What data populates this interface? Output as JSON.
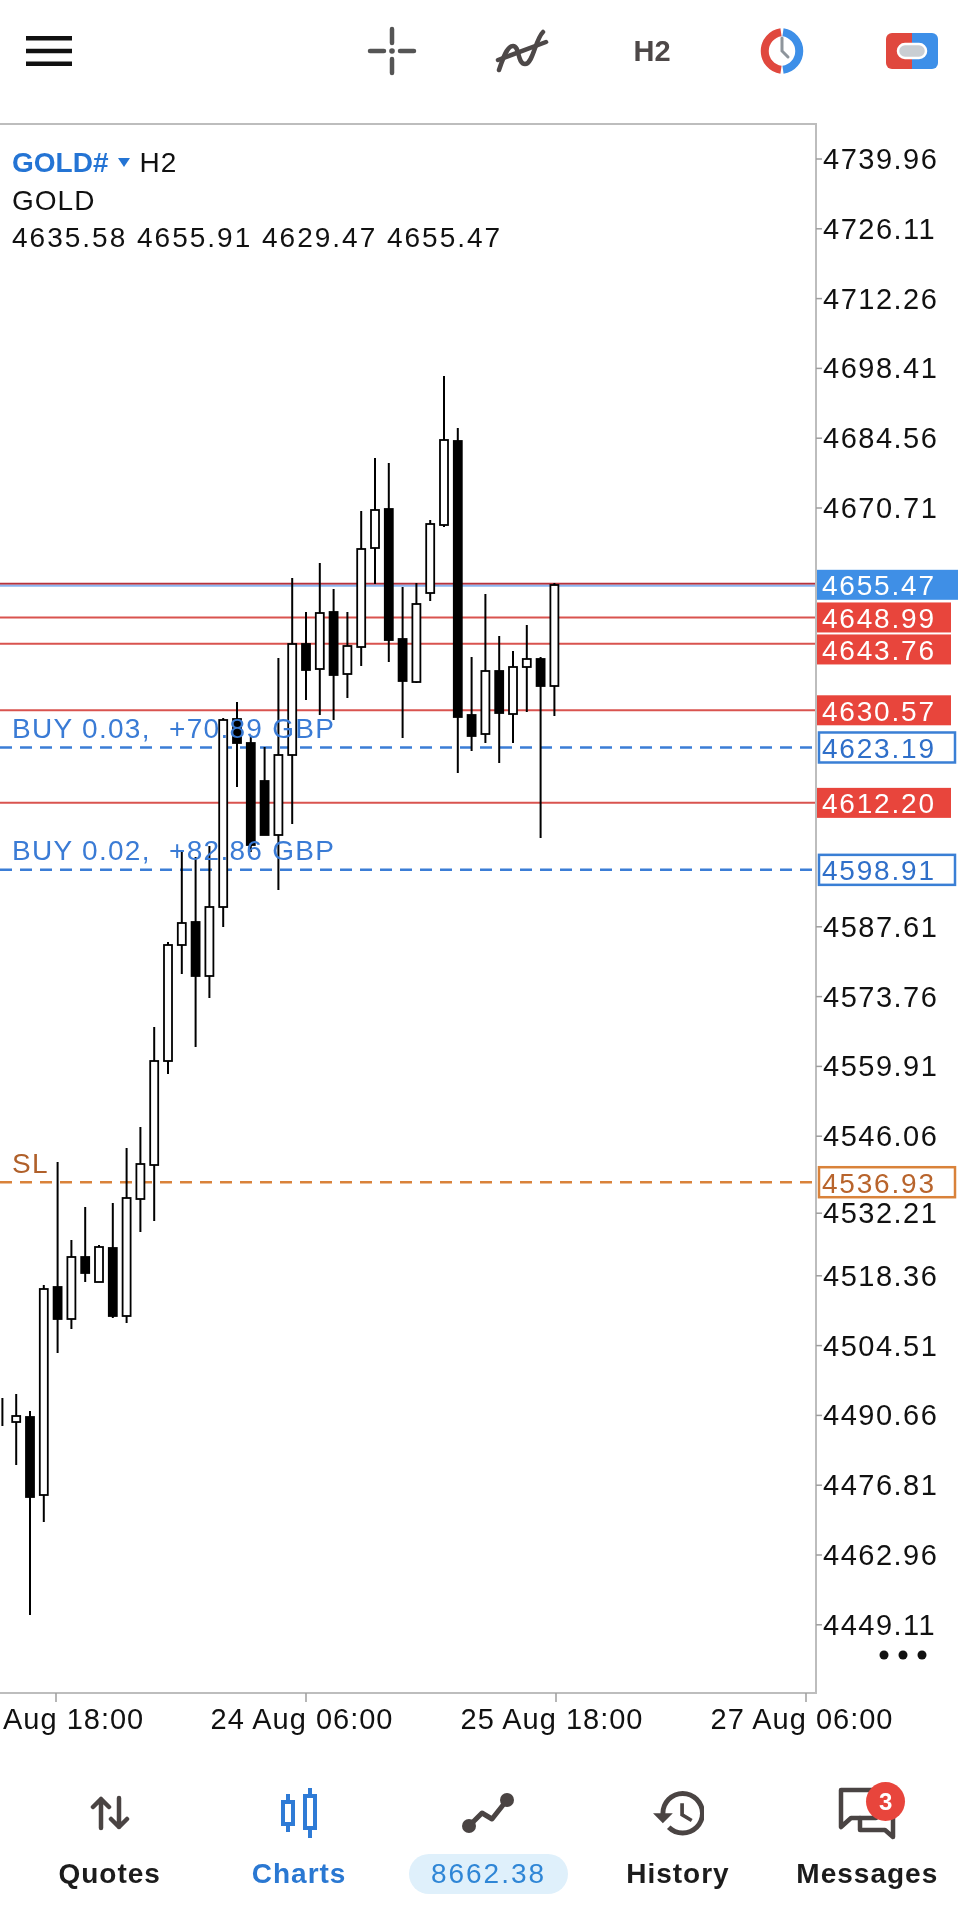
{
  "top_bar": {
    "timeframe": "H2"
  },
  "chart": {
    "symbol": "GOLD#",
    "timeframe": "H2",
    "description": "GOLD",
    "ohlc": "4635.58 4655.91 4629.47 4655.47",
    "price_ticks": [
      "4739.96",
      "4726.11",
      "4712.26",
      "4698.41",
      "4684.56",
      "4670.71",
      "4587.61",
      "4573.76",
      "4559.91",
      "4546.06",
      "4532.21",
      "4518.36",
      "4504.51",
      "4490.66",
      "4476.81",
      "4462.96",
      "4449.11"
    ],
    "price_lines": [
      {
        "kind": "bid",
        "price": "4655.47"
      },
      {
        "kind": "level",
        "price": "4648.99"
      },
      {
        "kind": "level",
        "price": "4643.76"
      },
      {
        "kind": "level",
        "price": "4630.57"
      },
      {
        "kind": "position",
        "price": "4623.19",
        "label": "BUY 0.03,  +70.89 GBP"
      },
      {
        "kind": "level",
        "price": "4612.20"
      },
      {
        "kind": "position",
        "price": "4598.91",
        "label": "BUY 0.02,  +82.86 GBP"
      },
      {
        "kind": "stop_loss",
        "price": "4536.93",
        "label": "SL"
      }
    ],
    "time_labels": [
      "Aug 18:00",
      "24 Aug 06:00",
      "25 Aug 18:00",
      "27 Aug 06:00"
    ]
  },
  "bottom_nav": [
    {
      "label": "Quotes",
      "kind": "tab",
      "selected": false
    },
    {
      "label": "Charts",
      "kind": "tab",
      "selected": true
    },
    {
      "label": "8662.38",
      "kind": "balance",
      "selected": false
    },
    {
      "label": "History",
      "kind": "tab",
      "selected": false
    },
    {
      "label": "Messages",
      "kind": "tab",
      "selected": false,
      "badge": "3"
    }
  ]
}
